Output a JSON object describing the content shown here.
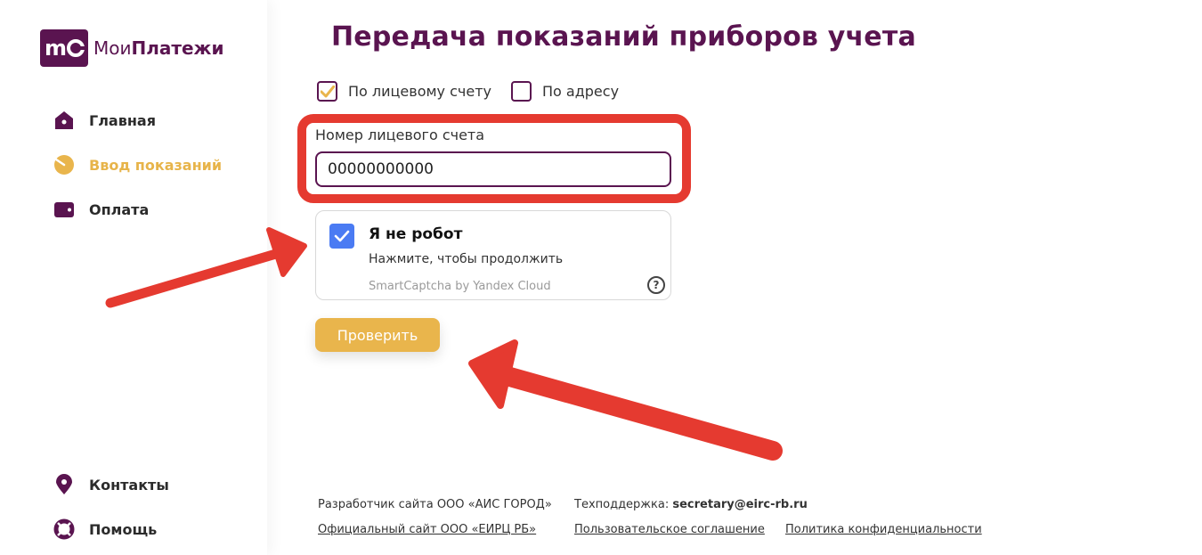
{
  "logo": {
    "prefix": "Мои",
    "brand": "Платежи"
  },
  "sidebar": {
    "items": [
      {
        "label": "Главная"
      },
      {
        "label": "Ввод показаний"
      },
      {
        "label": "Оплата"
      }
    ],
    "bottom_items": [
      {
        "label": "Контакты"
      },
      {
        "label": "Помощь"
      }
    ]
  },
  "main": {
    "title": "Передача показаний приборов учета",
    "mode_options": [
      {
        "label": "По лицевому счету",
        "checked": true
      },
      {
        "label": "По адресу",
        "checked": false
      }
    ],
    "account_field": {
      "label": "Номер лицевого счета",
      "value": "00000000000"
    },
    "captcha": {
      "title": "Я не робот",
      "subtitle": "Нажмите, чтобы продолжить",
      "brand": "SmartCaptcha by Yandex Cloud",
      "help": "?"
    },
    "submit_label": "Проверить"
  },
  "footer": {
    "developer": "Разработчик сайта ООО «АИС ГОРОД»",
    "support_label": "Техподдержка:",
    "support_email": "secretary@eirc-rb.ru",
    "official_site": "Официальный сайт ООО «ЕИРЦ РБ»",
    "user_agreement": "Пользовательское соглашение",
    "privacy_policy": "Политика конфиденциальности"
  },
  "colors": {
    "brand_purple": "#5a1450",
    "accent_yellow": "#e9b54c",
    "highlight_red": "#e53a30",
    "captcha_blue": "#4a7bf3"
  }
}
